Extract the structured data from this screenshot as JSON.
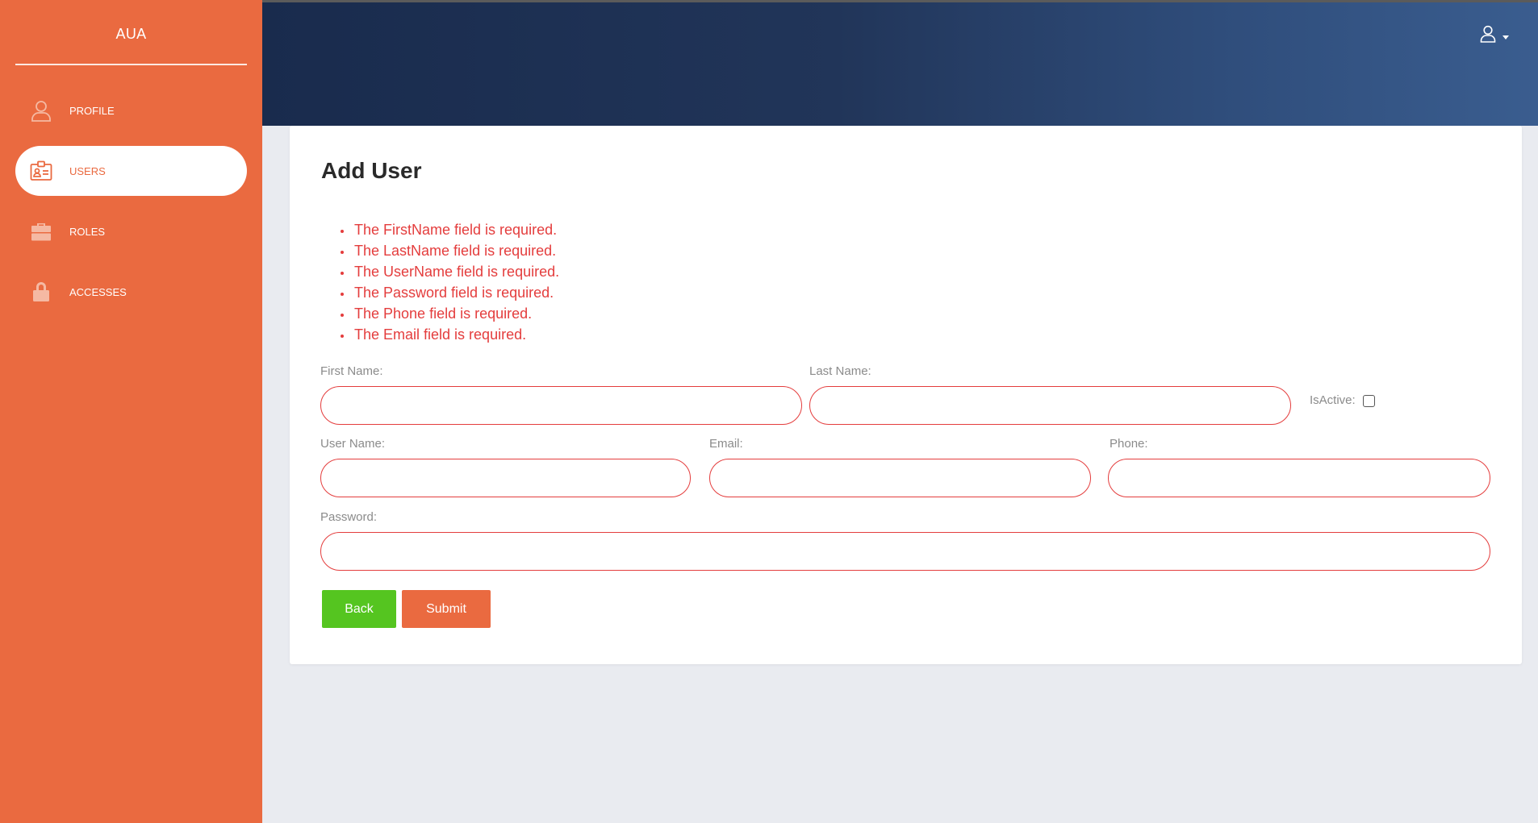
{
  "sidebar": {
    "brand": "AUA",
    "items": [
      {
        "label": "PROFILE",
        "icon": "user-outline-icon"
      },
      {
        "label": "USERS",
        "icon": "id-card-icon"
      },
      {
        "label": "ROLES",
        "icon": "briefcase-icon"
      },
      {
        "label": "ACCESSES",
        "icon": "lock-icon"
      }
    ]
  },
  "header": {
    "user_menu_icon": "user-icon",
    "dropdown_icon": "caret-down-icon"
  },
  "page": {
    "title": "Add User"
  },
  "errors": [
    "The FirstName field is required.",
    "The LastName field is required.",
    "The UserName field is required.",
    "The Password field is required.",
    "The Phone field is required.",
    "The Email field is required."
  ],
  "form": {
    "first_name_label": "First Name:",
    "first_name_value": "",
    "last_name_label": "Last Name:",
    "last_name_value": "",
    "is_active_label": "IsActive:",
    "is_active_checked": false,
    "user_name_label": "User Name:",
    "user_name_value": "",
    "email_label": "Email:",
    "email_value": "",
    "phone_label": "Phone:",
    "phone_value": "",
    "password_label": "Password:",
    "password_value": ""
  },
  "buttons": {
    "back": "Back",
    "submit": "Submit"
  },
  "colors": {
    "sidebar": "#ea6a40",
    "error": "#e43d3d",
    "back_button": "#55c520",
    "submit_button": "#ea6a40",
    "header_dark": "#192b4d",
    "header_light": "#3a5d8f"
  }
}
